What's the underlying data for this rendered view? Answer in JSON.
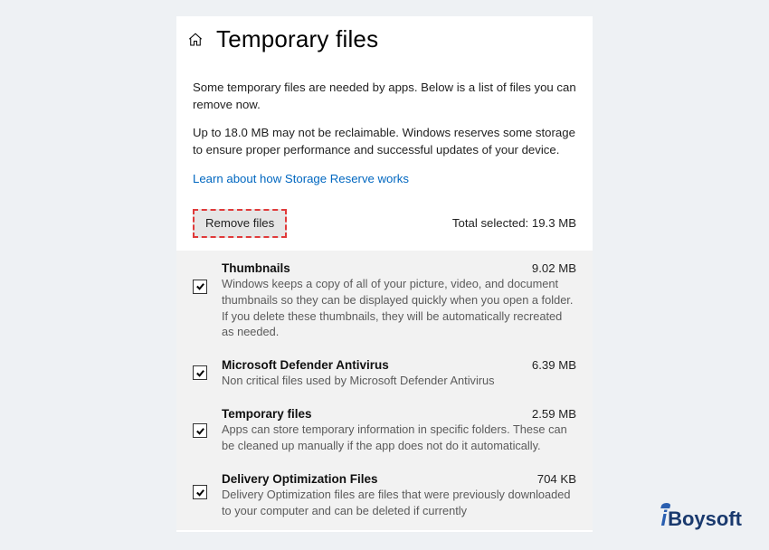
{
  "header": {
    "title": "Temporary files"
  },
  "intro": {
    "p1": "Some temporary files are needed by apps. Below is a list of files you can remove now.",
    "p2": "Up to 18.0 MB may not be reclaimable. Windows reserves some storage to ensure proper performance and successful updates of your device.",
    "link": "Learn about how Storage Reserve works"
  },
  "actions": {
    "remove_label": "Remove files",
    "total_selected_label": "Total selected: 19.3 MB"
  },
  "files": [
    {
      "title": "Thumbnails",
      "size": "9.02 MB",
      "desc": "Windows keeps a copy of all of your picture, video, and document thumbnails so they can be displayed quickly when you open a folder. If you delete these thumbnails, they will be automatically recreated as needed."
    },
    {
      "title": "Microsoft Defender Antivirus",
      "size": "6.39 MB",
      "desc": "Non critical files used by Microsoft Defender Antivirus"
    },
    {
      "title": "Temporary files",
      "size": "2.59 MB",
      "desc": "Apps can store temporary information in specific folders. These can be cleaned up manually if the app does not do it automatically."
    },
    {
      "title": "Delivery Optimization Files",
      "size": "704 KB",
      "desc": "Delivery Optimization files are files that were previously downloaded to your computer and can be deleted if currently"
    }
  ],
  "watermark": {
    "i": "i",
    "rest": "Boysoft"
  }
}
